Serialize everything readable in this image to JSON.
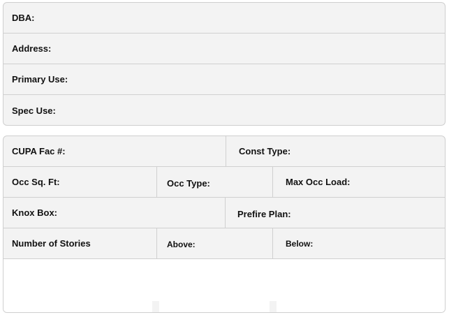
{
  "property_info": {
    "dba_label": "DBA:",
    "address_label": "Address:",
    "primary_use_label": "Primary Use:",
    "spec_use_label": "Spec Use:"
  },
  "building_info": {
    "cupa_fac_label": "CUPA Fac #:",
    "const_type_label": "Const Type:",
    "occ_sq_ft_label": "Occ Sq. Ft:",
    "occ_type_label": "Occ Type:",
    "max_occ_load_label": "Max Occ Load:",
    "knox_box_label": "Knox Box:",
    "prefire_plan_label": "Prefire Plan:",
    "number_of_stories_label": "Number of Stories",
    "above_label": "Above:",
    "below_label": "Below:"
  }
}
